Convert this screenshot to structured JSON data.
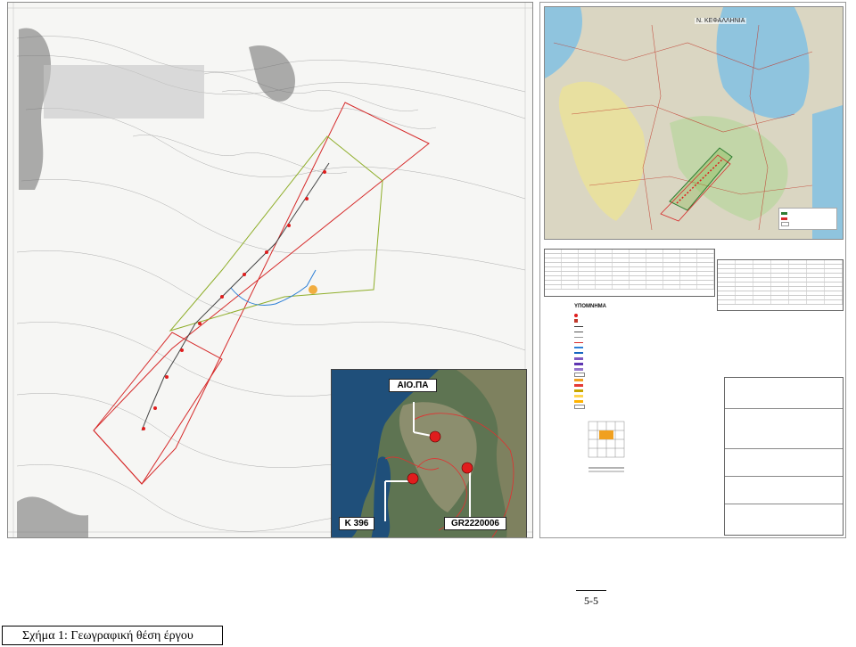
{
  "inset_labels": {
    "aio": "ΑΙΟ.ΠΑ",
    "k": "K 396",
    "gr": "GR2220006"
  },
  "right_panel": {
    "region_label": "Ν. ΚΕΦΑΛΛΗΝΙΑ",
    "legend_title": "ΥΠΟΜΝΗΜΑ"
  },
  "footer": {
    "page_number": "5-5",
    "caption": "Σχήμα 1: Γεωγραφική θέση έργου"
  },
  "colors": {
    "boundary_red": "#d62b2b",
    "boundary_green": "#8fae2a",
    "water_blue": "#2c7fd6",
    "marker_red": "#e01d1d",
    "site_orange": "#f0a020"
  }
}
